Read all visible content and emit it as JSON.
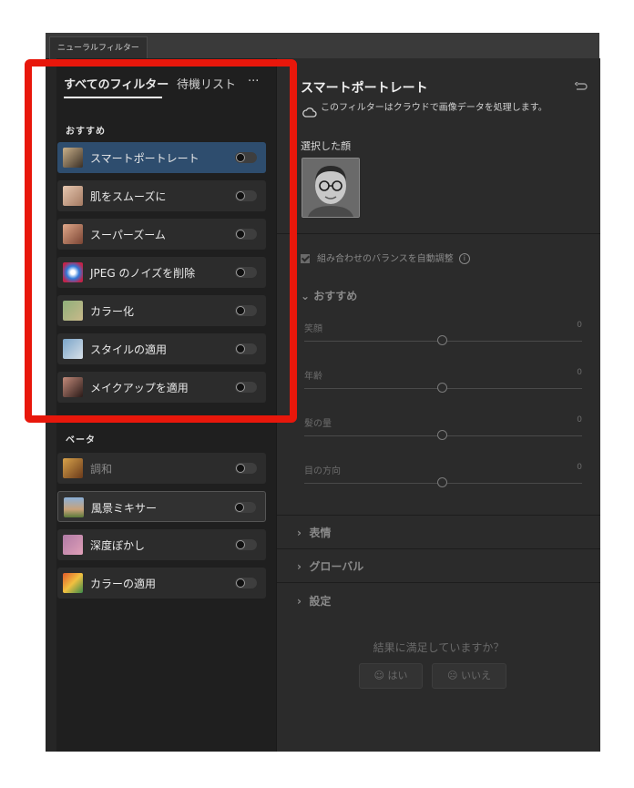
{
  "window": {
    "tab_title": "ニューラルフィルター"
  },
  "left_panel": {
    "tabs": {
      "all_filters": "すべてのフィルター",
      "wait_list": "待機リスト",
      "more": "···"
    },
    "featured_label": "おすすめ",
    "featured": [
      {
        "label": "スマートポートレート",
        "selected": true
      },
      {
        "label": "肌をスムーズに"
      },
      {
        "label": "スーパーズーム"
      },
      {
        "label": "JPEG のノイズを削除"
      },
      {
        "label": "カラー化"
      },
      {
        "label": "スタイルの適用"
      },
      {
        "label": "メイクアップを適用"
      }
    ],
    "beta_label": "ベータ",
    "beta": [
      {
        "label": "調和",
        "dimmed": true
      },
      {
        "label": "風景ミキサー",
        "hovered": true
      },
      {
        "label": "深度ぼかし"
      },
      {
        "label": "カラーの適用"
      }
    ]
  },
  "right_panel": {
    "title": "スマートポートレート",
    "cloud_note": "このフィルターはクラウドで画像データを処理します。",
    "selected_face_label": "選択した顔",
    "auto_balance_label": "組み合わせのバランスを自動調整",
    "featured_section": "おすすめ",
    "sliders": [
      {
        "label": "笑顔",
        "value": "0"
      },
      {
        "label": "年齢",
        "value": "0"
      },
      {
        "label": "髪の量",
        "value": "0"
      },
      {
        "label": "目の方向",
        "value": "0"
      }
    ],
    "collapsed_sections": [
      "表情",
      "グローバル",
      "設定"
    ],
    "feedback_question": "結果に満足していますか？",
    "yes_label": "はい",
    "no_label": "いいえ"
  },
  "colors": {
    "highlight": "#e8170b",
    "selected": "#2e4d6e"
  }
}
